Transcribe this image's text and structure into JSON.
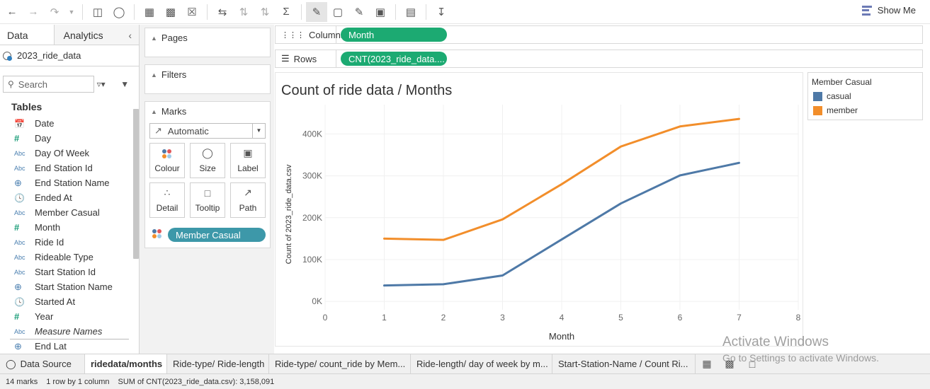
{
  "toolbar": {
    "show_me_label": "Show Me"
  },
  "left_pane": {
    "tabs": [
      "Data",
      "Analytics"
    ],
    "datasource_name": "2023_ride_data",
    "search_placeholder": "Search",
    "tables_header": "Tables",
    "fields": [
      {
        "icon": "calendar-icon",
        "glyph": "📅",
        "type": "cal",
        "label": "Date"
      },
      {
        "icon": "number-icon",
        "glyph": "#",
        "type": "hash",
        "label": "Day"
      },
      {
        "icon": "string-icon",
        "glyph": "Abc",
        "type": "abc",
        "label": "Day Of Week"
      },
      {
        "icon": "string-icon",
        "glyph": "Abc",
        "type": "abc",
        "label": "End Station Id"
      },
      {
        "icon": "globe-icon",
        "glyph": "⊕",
        "type": "geo",
        "label": "End Station Name"
      },
      {
        "icon": "datetime-icon",
        "glyph": "🕓",
        "type": "cal",
        "label": "Ended At"
      },
      {
        "icon": "string-icon",
        "glyph": "Abc",
        "type": "abc",
        "label": "Member Casual"
      },
      {
        "icon": "number-icon",
        "glyph": "#",
        "type": "hash",
        "label": "Month"
      },
      {
        "icon": "string-icon",
        "glyph": "Abc",
        "type": "abc",
        "label": "Ride Id"
      },
      {
        "icon": "string-icon",
        "glyph": "Abc",
        "type": "abc",
        "label": "Rideable Type"
      },
      {
        "icon": "string-icon",
        "glyph": "Abc",
        "type": "abc",
        "label": "Start Station Id"
      },
      {
        "icon": "globe-icon",
        "glyph": "⊕",
        "type": "geo",
        "label": "Start Station Name"
      },
      {
        "icon": "datetime-icon",
        "glyph": "🕓",
        "type": "cal",
        "label": "Started At"
      },
      {
        "icon": "number-icon",
        "glyph": "#",
        "type": "hash",
        "label": "Year"
      },
      {
        "icon": "string-icon",
        "glyph": "Abc",
        "type": "abc",
        "label": "Measure Names",
        "italic": true
      },
      {
        "icon": "globe-icon",
        "glyph": "⊕",
        "type": "geo",
        "label": "End Lat"
      }
    ]
  },
  "cards": {
    "pages": "Pages",
    "filters": "Filters",
    "marks": "Marks",
    "mark_type": "Automatic",
    "buttons": [
      "Colour",
      "Size",
      "Label",
      "Detail",
      "Tooltip",
      "Path"
    ],
    "color_pill": "Member Casual"
  },
  "shelves": {
    "columns_label": "Columns",
    "columns_pill": "Month",
    "rows_label": "Rows",
    "rows_pill": "CNT(2023_ride_data...."
  },
  "legend": {
    "title": "Member Casual",
    "items": [
      {
        "label": "casual",
        "color": "#4e79a7"
      },
      {
        "label": "member",
        "color": "#f28e2b"
      }
    ]
  },
  "chart_data": {
    "type": "line",
    "title": "Count of ride data / Months",
    "xlabel": "Month",
    "ylabel": "Count of 2023_ride_data.csv",
    "xlim": [
      0,
      8
    ],
    "ylim": [
      -20000,
      470000
    ],
    "x_ticks": [
      0,
      1,
      2,
      3,
      4,
      5,
      6,
      7,
      8
    ],
    "y_ticks": [
      0,
      100000,
      200000,
      300000,
      400000
    ],
    "y_tick_labels": [
      "0K",
      "100K",
      "200K",
      "300K",
      "400K"
    ],
    "x": [
      1,
      2,
      3,
      4,
      5,
      6,
      7
    ],
    "series": [
      {
        "name": "casual",
        "color": "#4e79a7",
        "values": [
          38000,
          41000,
          62000,
          148000,
          234000,
          301000,
          331000
        ]
      },
      {
        "name": "member",
        "color": "#f28e2b",
        "values": [
          150000,
          147000,
          196000,
          280000,
          370000,
          418000,
          436000
        ]
      }
    ]
  },
  "sheet_tabs": {
    "data_source": "Data Source",
    "sheets": [
      "ridedata/months",
      "Ride-type/ Ride-length",
      "Ride-type/ count_ride by Mem...",
      "Ride-length/ day of week by m...",
      "Start-Station-Name / Count Ri..."
    ]
  },
  "status": {
    "marks": "14 marks",
    "rows_cols": "1 row by 1 column",
    "sum": "SUM of CNT(2023_ride_data.csv): 3,158,091"
  },
  "watermark": {
    "title": "Activate Windows",
    "subtitle": "Go to Settings to activate Windows."
  }
}
